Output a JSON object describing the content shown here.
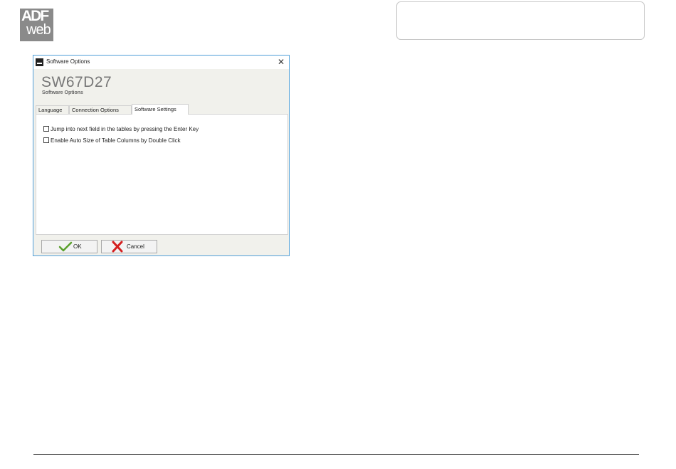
{
  "logo": {
    "line1": "ADF",
    "line2": "web"
  },
  "dialog": {
    "title": "Software Options",
    "close_glyph": "✕",
    "heading": "SW67D27",
    "subheading": "Software Options",
    "tabs": [
      {
        "label": "Language",
        "active": false
      },
      {
        "label": "Connection Options",
        "active": false
      },
      {
        "label": "Software Settings",
        "active": true
      }
    ],
    "options": [
      {
        "label": "Jump into next field in the tables by pressing the Enter Key",
        "checked": false
      },
      {
        "label": "Enable Auto Size of Table Columns by Double Click",
        "checked": false
      }
    ],
    "buttons": {
      "ok": "OK",
      "cancel": "Cancel"
    },
    "icons": {
      "ok": "checkmark-icon",
      "cancel": "red-x-icon",
      "app": "adfweb-app-icon"
    },
    "colors": {
      "ok_icon": "#5aa02c",
      "cancel_icon": "#d42020",
      "window_border": "#4f9fd8"
    }
  }
}
